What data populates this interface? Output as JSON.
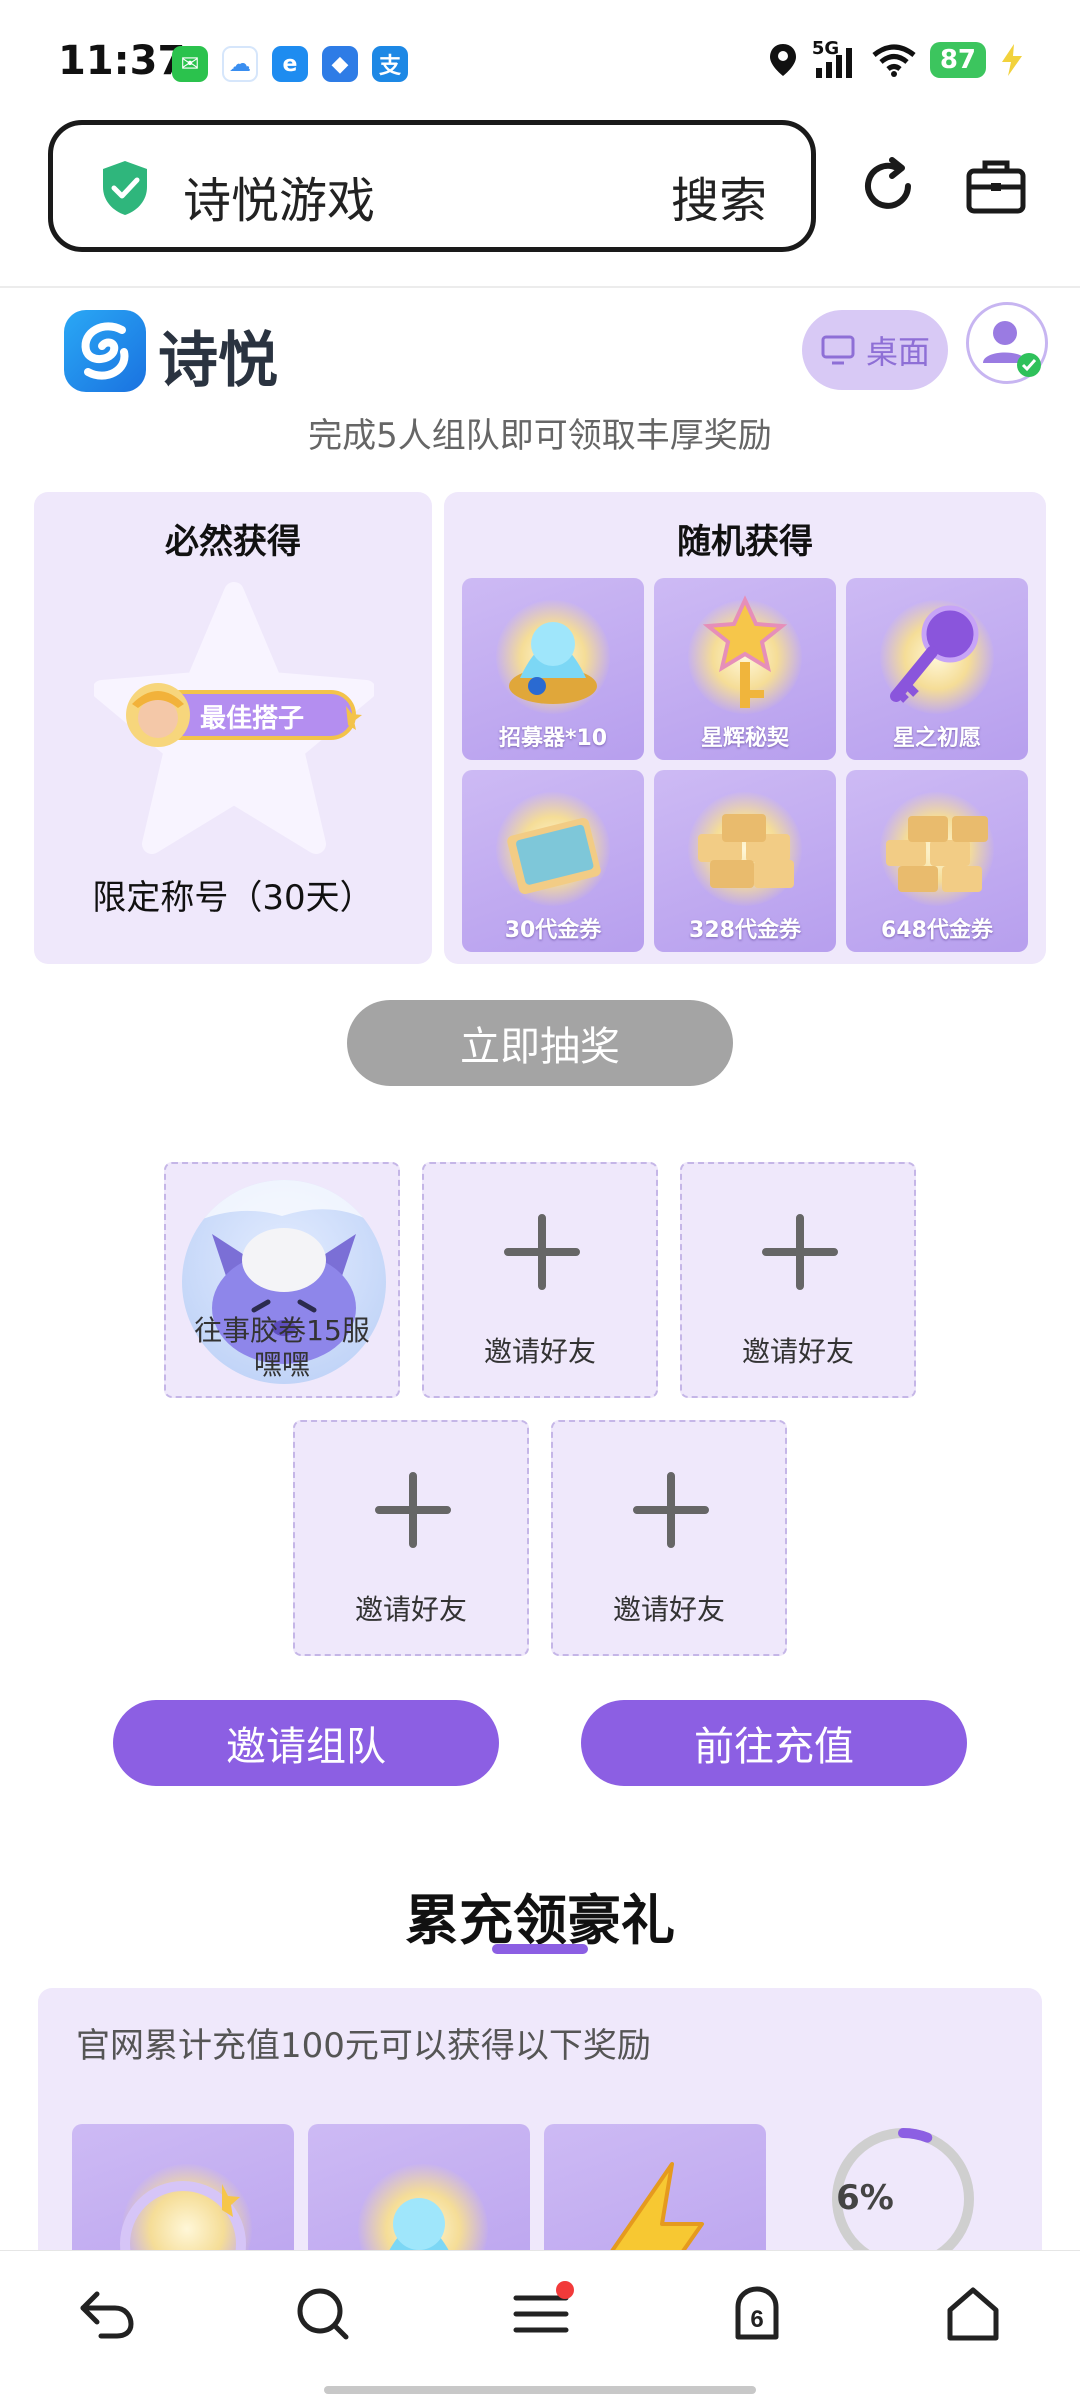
{
  "status_bar": {
    "time": "11:37",
    "network": "5G",
    "battery": "87",
    "app_icons": [
      "wechat-icon",
      "app-cloud-icon",
      "browser-e-icon",
      "app-bird-icon",
      "alipay-icon"
    ]
  },
  "browser": {
    "address_text": "诗悦游戏",
    "search_label": "搜索"
  },
  "site": {
    "logo_text": "诗悦",
    "desktop_label": "桌面"
  },
  "team": {
    "hint": "完成5人组队即可领取丰厚奖励",
    "guaranteed": {
      "title": "必然获得",
      "badge_text": "最佳搭子",
      "note": "限定称号（30天）"
    },
    "random": {
      "title": "随机获得",
      "items": [
        {
          "label": "招募器*10"
        },
        {
          "label": "星辉秘契"
        },
        {
          "label": "星之初愿"
        },
        {
          "label": "30代金券"
        },
        {
          "label": "328代金券"
        },
        {
          "label": "648代金券"
        }
      ]
    },
    "draw_button": "立即抽奖",
    "member": {
      "name_line1": "往事胶卷15服",
      "name_line2": "嘿嘿"
    },
    "invite_slots": [
      {
        "label": "邀请好友"
      },
      {
        "label": "邀请好友"
      },
      {
        "label": "邀请好友"
      },
      {
        "label": "邀请好友"
      }
    ],
    "invite_button": "邀请组队",
    "recharge_button": "前往充值"
  },
  "recharge": {
    "title": "累充领豪礼",
    "description": "官网累计充值100元可以获得以下奖励",
    "progress_text": "6%",
    "progress_value": 0.06
  },
  "colors": {
    "accent": "#8c5fe3",
    "panel_bg": "#efe8fb",
    "disabled": "#a4a4a4"
  }
}
